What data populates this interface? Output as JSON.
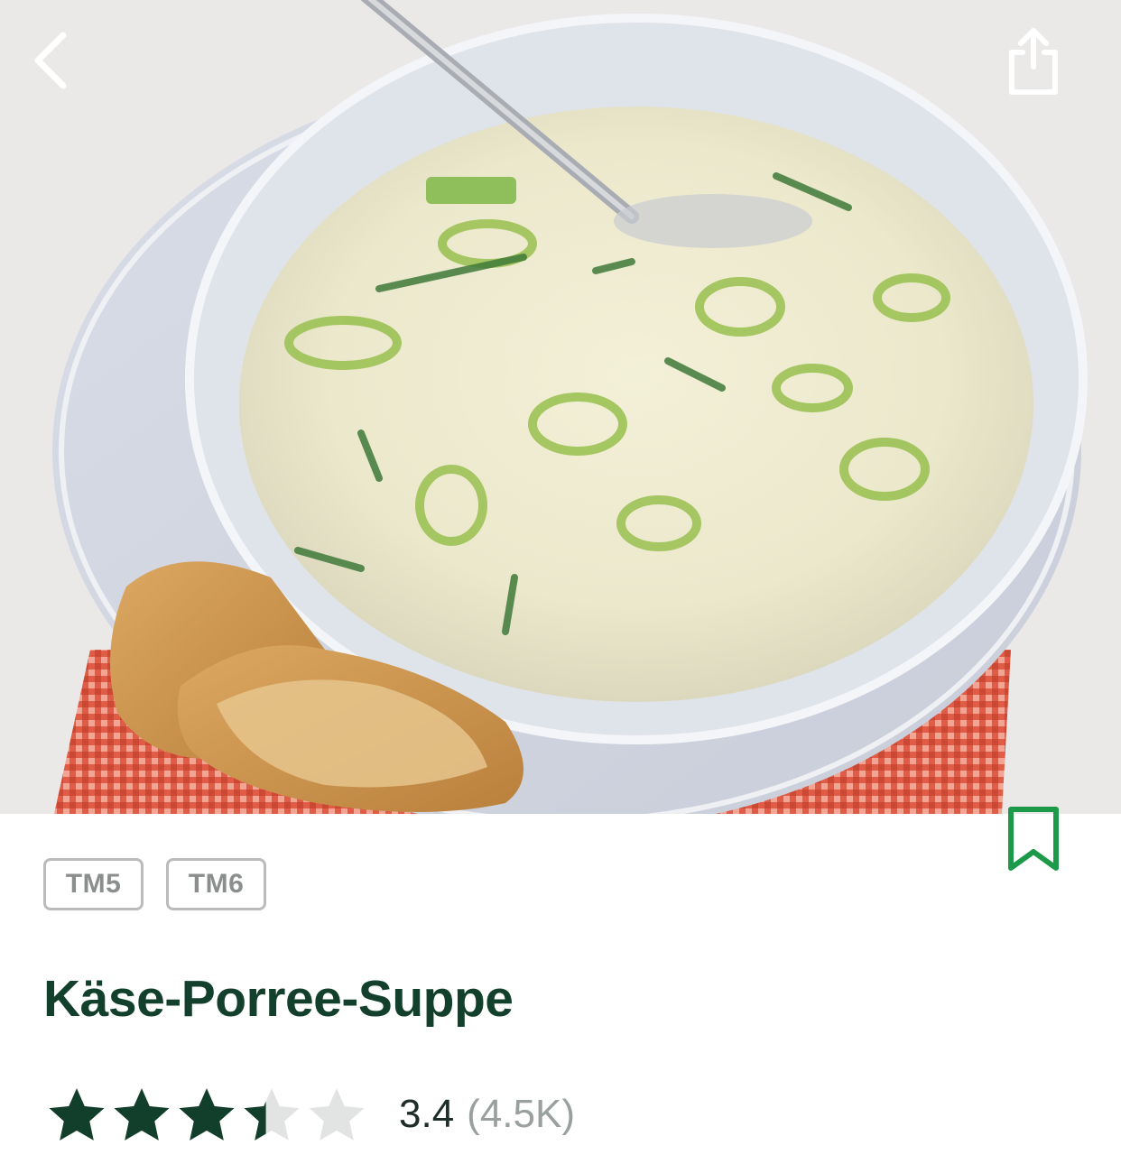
{
  "header": {
    "back_icon": "chevron-left-icon",
    "share_icon": "share-icon"
  },
  "hero": {
    "subject": "recipe-photo"
  },
  "recipe": {
    "bookmark_icon": "bookmark-icon",
    "tags": [
      "TM5",
      "TM6"
    ],
    "title": "Käse-Porree-Suppe",
    "rating": {
      "value": "3.4",
      "count": "(4.5K)",
      "stars_filled_fraction": 0.68
    }
  },
  "colors": {
    "title": "#12402c",
    "star_filled": "#123f2b",
    "star_empty": "#e2e4e3",
    "bookmark": "#1c9a4a",
    "tag_border": "#b9bcbb"
  }
}
